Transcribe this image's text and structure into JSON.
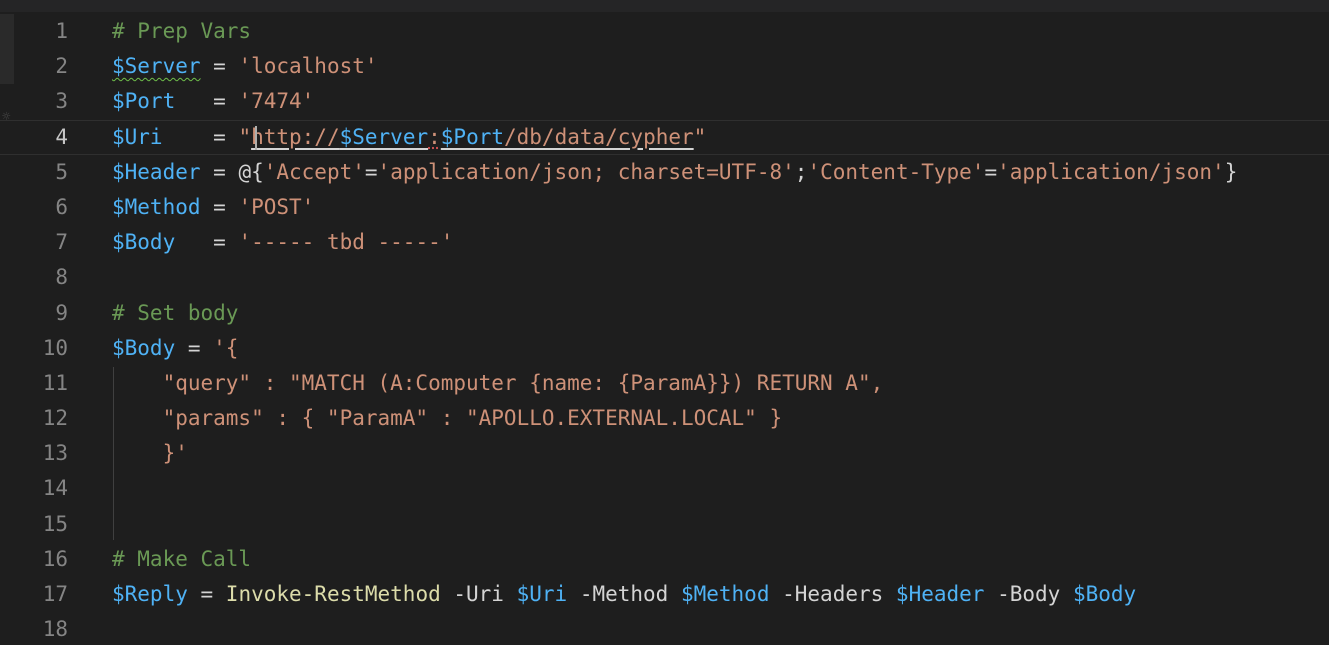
{
  "editor": {
    "lines": [
      {
        "n": "1",
        "tokens": [
          {
            "t": "# Prep Vars",
            "c": "comment"
          }
        ]
      },
      {
        "n": "2",
        "tokens": [
          {
            "t": "$Server",
            "c": "var",
            "u": "squiggle-green"
          },
          {
            "t": " = ",
            "c": "op"
          },
          {
            "t": "'localhost'",
            "c": "str"
          }
        ]
      },
      {
        "n": "3",
        "tokens": [
          {
            "t": "$Port",
            "c": "var"
          },
          {
            "t": "   = ",
            "c": "op"
          },
          {
            "t": "'7474'",
            "c": "str"
          }
        ]
      },
      {
        "n": "4",
        "active": true,
        "tokens": [
          {
            "t": "$Uri",
            "c": "var"
          },
          {
            "t": "    = ",
            "c": "op"
          },
          {
            "t": "\"",
            "c": "str"
          },
          {
            "t": "http://",
            "c": "str",
            "u": "ulink"
          },
          {
            "t": "$Server",
            "c": "var",
            "u": "ulink"
          },
          {
            "t": ":",
            "c": "str",
            "u": "squiggle-red"
          },
          {
            "t": "$Port",
            "c": "var",
            "u": "ulink"
          },
          {
            "t": "/db/data/cypher",
            "c": "str",
            "u": "ulink"
          },
          {
            "t": "\"",
            "c": "str"
          }
        ]
      },
      {
        "n": "5",
        "tokens": [
          {
            "t": "$Header",
            "c": "var"
          },
          {
            "t": " = @{",
            "c": "op"
          },
          {
            "t": "'Accept'",
            "c": "str"
          },
          {
            "t": "=",
            "c": "op"
          },
          {
            "t": "'application/json; charset=UTF-8'",
            "c": "str"
          },
          {
            "t": ";",
            "c": "op"
          },
          {
            "t": "'Content-Type'",
            "c": "str"
          },
          {
            "t": "=",
            "c": "op"
          },
          {
            "t": "'application/json'",
            "c": "str"
          },
          {
            "t": "}",
            "c": "op"
          }
        ]
      },
      {
        "n": "6",
        "tokens": [
          {
            "t": "$Method",
            "c": "var"
          },
          {
            "t": " = ",
            "c": "op"
          },
          {
            "t": "'POST'",
            "c": "str"
          }
        ]
      },
      {
        "n": "7",
        "tokens": [
          {
            "t": "$Body",
            "c": "var"
          },
          {
            "t": "   = ",
            "c": "op"
          },
          {
            "t": "'----- tbd -----'",
            "c": "str"
          }
        ]
      },
      {
        "n": "8",
        "tokens": []
      },
      {
        "n": "9",
        "tokens": [
          {
            "t": "# Set body",
            "c": "comment"
          }
        ]
      },
      {
        "n": "10",
        "tokens": [
          {
            "t": "$Body",
            "c": "var"
          },
          {
            "t": " = ",
            "c": "op"
          },
          {
            "t": "'{",
            "c": "str"
          }
        ]
      },
      {
        "n": "11",
        "tokens": [
          {
            "t": "    \"query\" : \"MATCH (A:Computer {name: {ParamA}}) RETURN A\",",
            "c": "str"
          }
        ]
      },
      {
        "n": "12",
        "tokens": [
          {
            "t": "    \"params\" : { \"ParamA\" : \"APOLLO.EXTERNAL.LOCAL\" }",
            "c": "str"
          }
        ]
      },
      {
        "n": "13",
        "tokens": [
          {
            "t": "    }'",
            "c": "str"
          }
        ]
      },
      {
        "n": "14",
        "tokens": []
      },
      {
        "n": "15",
        "tokens": []
      },
      {
        "n": "16",
        "tokens": [
          {
            "t": "# Make Call",
            "c": "comment"
          }
        ]
      },
      {
        "n": "17",
        "tokens": [
          {
            "t": "$Reply",
            "c": "var"
          },
          {
            "t": " = ",
            "c": "op"
          },
          {
            "t": "Invoke-RestMethod",
            "c": "fn"
          },
          {
            "t": " -Uri ",
            "c": "param"
          },
          {
            "t": "$Uri",
            "c": "var"
          },
          {
            "t": " -Method ",
            "c": "param"
          },
          {
            "t": "$Method",
            "c": "var"
          },
          {
            "t": " -Headers ",
            "c": "param"
          },
          {
            "t": "$Header",
            "c": "var"
          },
          {
            "t": " -Body ",
            "c": "param"
          },
          {
            "t": "$Body",
            "c": "var"
          }
        ]
      },
      {
        "n": "18",
        "tokens": []
      }
    ]
  },
  "colors": {
    "background": "#1e1e1e",
    "comment": "#6a9955",
    "variable": "#4fb2f5",
    "string": "#ce9178",
    "function": "#dcdcaa",
    "line_number": "#858585"
  }
}
